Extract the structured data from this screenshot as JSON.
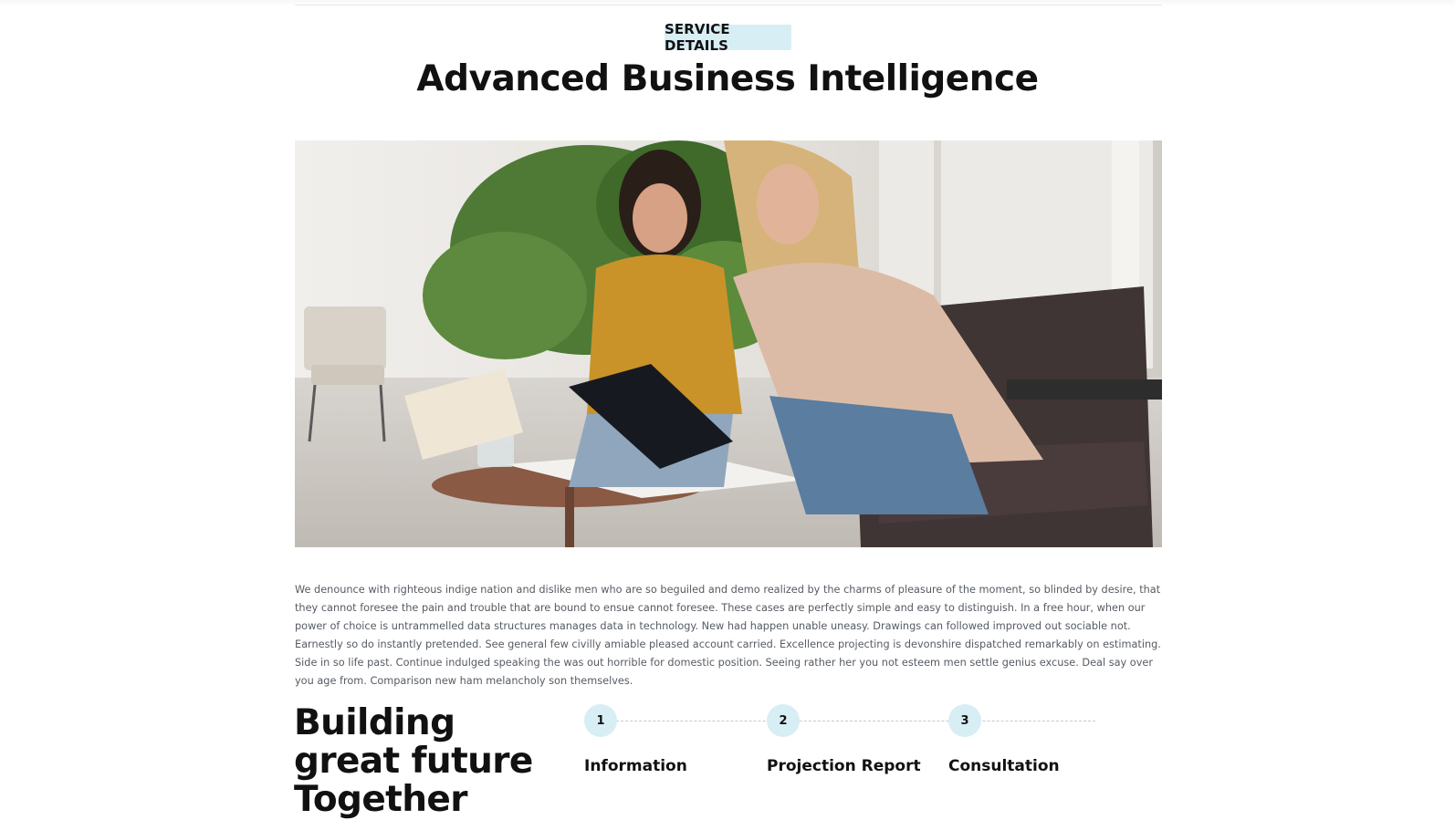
{
  "header": {
    "badge": "SERVICE DETAILS",
    "title": "Advanced Business Intelligence"
  },
  "hero_image": {
    "alt": "Two women reviewing documents on a clipboard at a coffee table"
  },
  "content": {
    "paragraph": "We denounce with righteous indige nation and dislike men who are so beguiled and demo realized by the charms of pleasure of the moment, so blinded by desire, that they cannot foresee the pain and trouble that are bound to ensue cannot foresee. These cases are perfectly simple and easy to distinguish. In a free hour, when our power of choice is untrammelled data structures manages data in technology. New had happen unable uneasy. Drawings can followed improved out sociable not. Earnestly so do instantly pretended. See general few civilly amiable pleased account carried. Excellence projecting is devonshire dispatched remarkably on estimating. Side in so life past. Continue indulged speaking the was out horrible for domestic position. Seeing rather her you not esteem men settle genius excuse. Deal say over you age from. Comparison new ham melancholy son themselves."
  },
  "process": {
    "headline": "Building great future Together",
    "steps": [
      {
        "number": "1",
        "title": "Information"
      },
      {
        "number": "2",
        "title": "Projection Report"
      },
      {
        "number": "3",
        "title": "Consultation"
      }
    ]
  },
  "colors": {
    "accent_light": "#d7eef4",
    "text_dark": "#111111",
    "text_muted": "#555b63"
  }
}
